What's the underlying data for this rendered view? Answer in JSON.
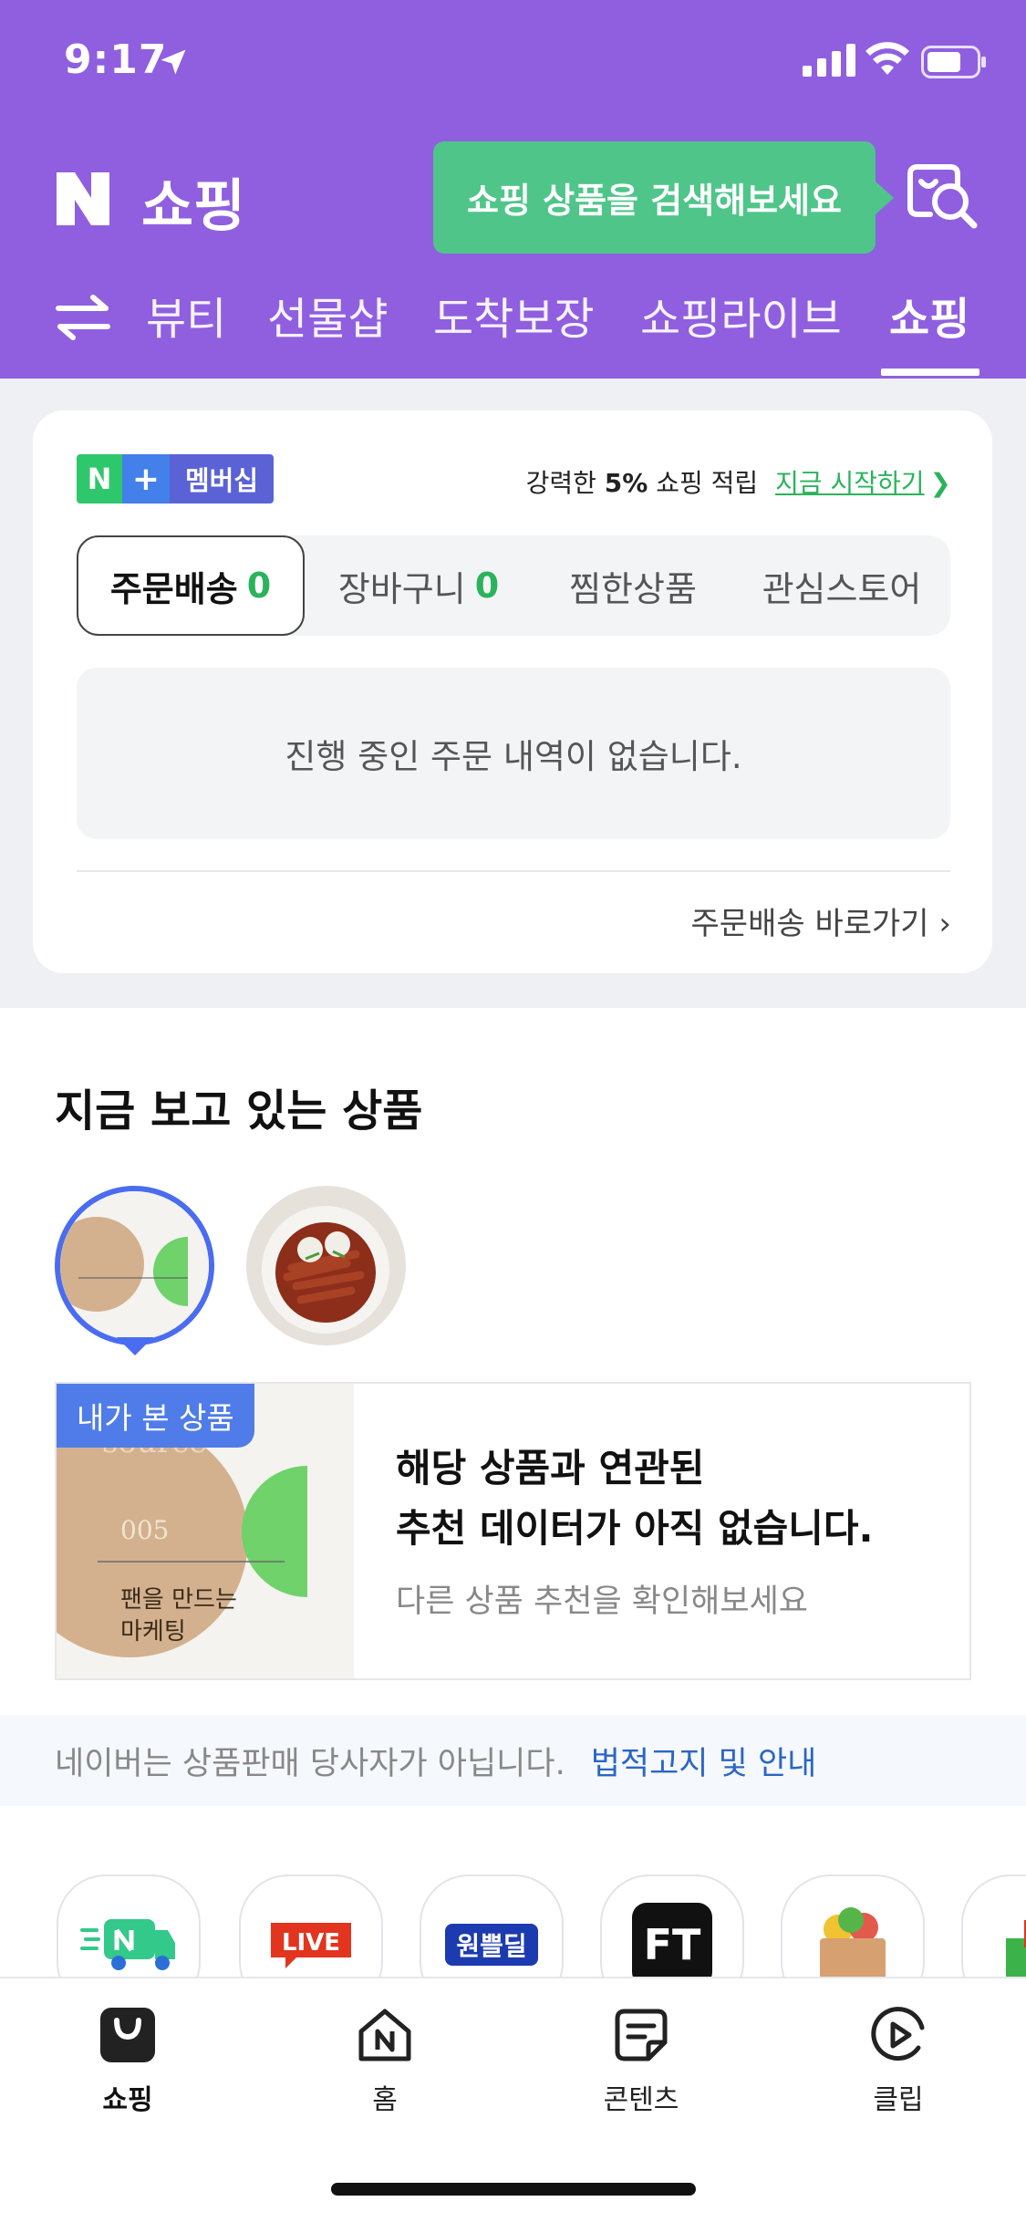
{
  "status_bar": {
    "time": "9:17"
  },
  "header": {
    "logo_text": "쇼핑",
    "tooltip": "쇼핑 상품을 검색해보세요",
    "tabs": [
      {
        "label": "뷰티"
      },
      {
        "label": "선물샵"
      },
      {
        "label": "도착보장"
      },
      {
        "label": "쇼핑라이브"
      },
      {
        "label": "쇼핑",
        "active": true
      }
    ]
  },
  "order_card": {
    "membership": {
      "n": "N",
      "plus": "+",
      "label": "멤버십"
    },
    "promo": {
      "prefix": "강력한",
      "highlight": "5%",
      "suffix": "쇼핑 적립",
      "link": "지금 시작하기"
    },
    "tabs": [
      {
        "label": "주문배송",
        "count": "0",
        "active": true
      },
      {
        "label": "장바구니",
        "count": "0"
      },
      {
        "label": "찜한상품"
      },
      {
        "label": "관심스토어"
      }
    ],
    "empty_message": "진행 중인 주문 내역이 없습니다.",
    "goto_label": "주문배송 바로가기"
  },
  "recent": {
    "title": "지금 보고 있는 상품",
    "book": {
      "line1": "source",
      "line2": "005",
      "line3": "팬을 만드는",
      "line4": "마케팅"
    },
    "badge": "내가 본 상품",
    "message_line1": "해당 상품과 연관된",
    "message_line2": "추천 데이터가 아직 없습니다.",
    "sub": "다른 상품 추천을 확인해보세요"
  },
  "notice": {
    "text": "네이버는 상품판매 당사자가 아닙니다.",
    "link": "법적고지 및 안내"
  },
  "shortcuts": {
    "live": "LIVE",
    "ft": "FT",
    "deal": "원쁠딜"
  },
  "bottom_nav": [
    {
      "label": "쇼핑",
      "icon": "shopping-bag-icon",
      "active": true
    },
    {
      "label": "홈",
      "icon": "home-icon"
    },
    {
      "label": "콘텐츠",
      "icon": "content-icon"
    },
    {
      "label": "클립",
      "icon": "clip-icon"
    }
  ],
  "colors": {
    "header_bg": "#8f5fe0",
    "accent_green": "#2bb35b",
    "tooltip_green": "#4fc58a",
    "link_blue": "#2b66c4"
  }
}
